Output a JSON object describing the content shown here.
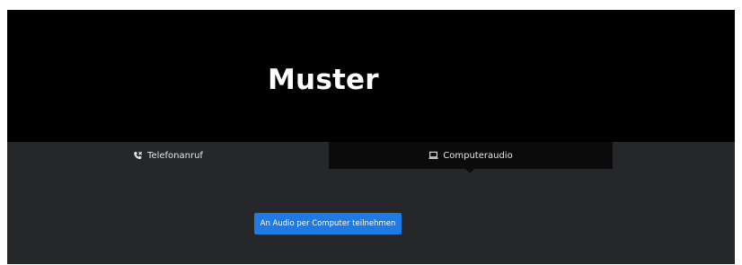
{
  "header": {
    "watermark_text": "Muster"
  },
  "tabs": [
    {
      "label": "Telefonanruf",
      "icon": "phone-icon",
      "selected": false
    },
    {
      "label": "Computeraudio",
      "icon": "laptop-icon",
      "selected": true
    }
  ],
  "main": {
    "join_button_label": "An Audio per Computer teilnehmen"
  },
  "colors": {
    "panel_background": "#26272a",
    "header_background": "#000000",
    "active_tab_background": "#0b0b0c",
    "button_blue": "#1f7ae6"
  }
}
